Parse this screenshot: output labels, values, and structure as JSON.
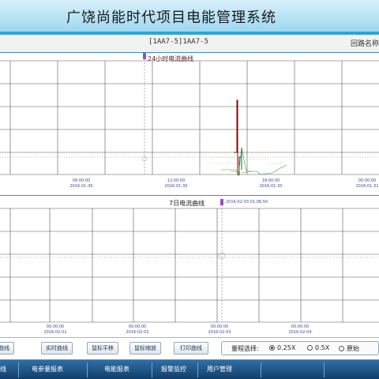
{
  "app": {
    "title": "广饶尚能时代项目电能管理系统"
  },
  "circuit": {
    "id": "[1AA7-5]1AA7-5",
    "name_label": "回路名称"
  },
  "top_chart": {
    "title": "24小时电流曲线",
    "x_ticks": [
      {
        "time": "06:00:00",
        "date": "2016-01-30"
      },
      {
        "time": "12:00:00",
        "date": "2016-01-30"
      },
      {
        "time": "18:00:00",
        "date": "2016-01-30"
      },
      {
        "time": "00:00:00",
        "date": "2016-01-31"
      }
    ]
  },
  "bottom_chart": {
    "title": "7日电流曲线",
    "cursor_label": "2016-02-03 01:06:50",
    "x_ticks": [
      {
        "time": "00:00:00",
        "date": "2016-02-01"
      },
      {
        "time": "00:00:00",
        "date": "2016-02-02"
      },
      {
        "time": "00:00:00",
        "date": "2016-02-03"
      },
      {
        "time": "00:00:00",
        "date": "2016-02-04"
      }
    ]
  },
  "toolbar": {
    "buttons": [
      "曲线",
      "实时曲线",
      "鼠标平移",
      "鼠标缩放",
      "打印曲线"
    ],
    "scale_label": "量程选择:",
    "scale_options": [
      "0.25X",
      "0.5X",
      "原始"
    ],
    "selected_scale": "0.25X"
  },
  "nav": {
    "items": [
      "线",
      "电参量报表",
      "电能报表",
      "报警监控",
      "用户管理"
    ]
  },
  "colors": {
    "title_bg": "#9ed7ef",
    "nav_bg": "#1b4f80",
    "grid": "#555555",
    "current_line": "#8b0000"
  }
}
